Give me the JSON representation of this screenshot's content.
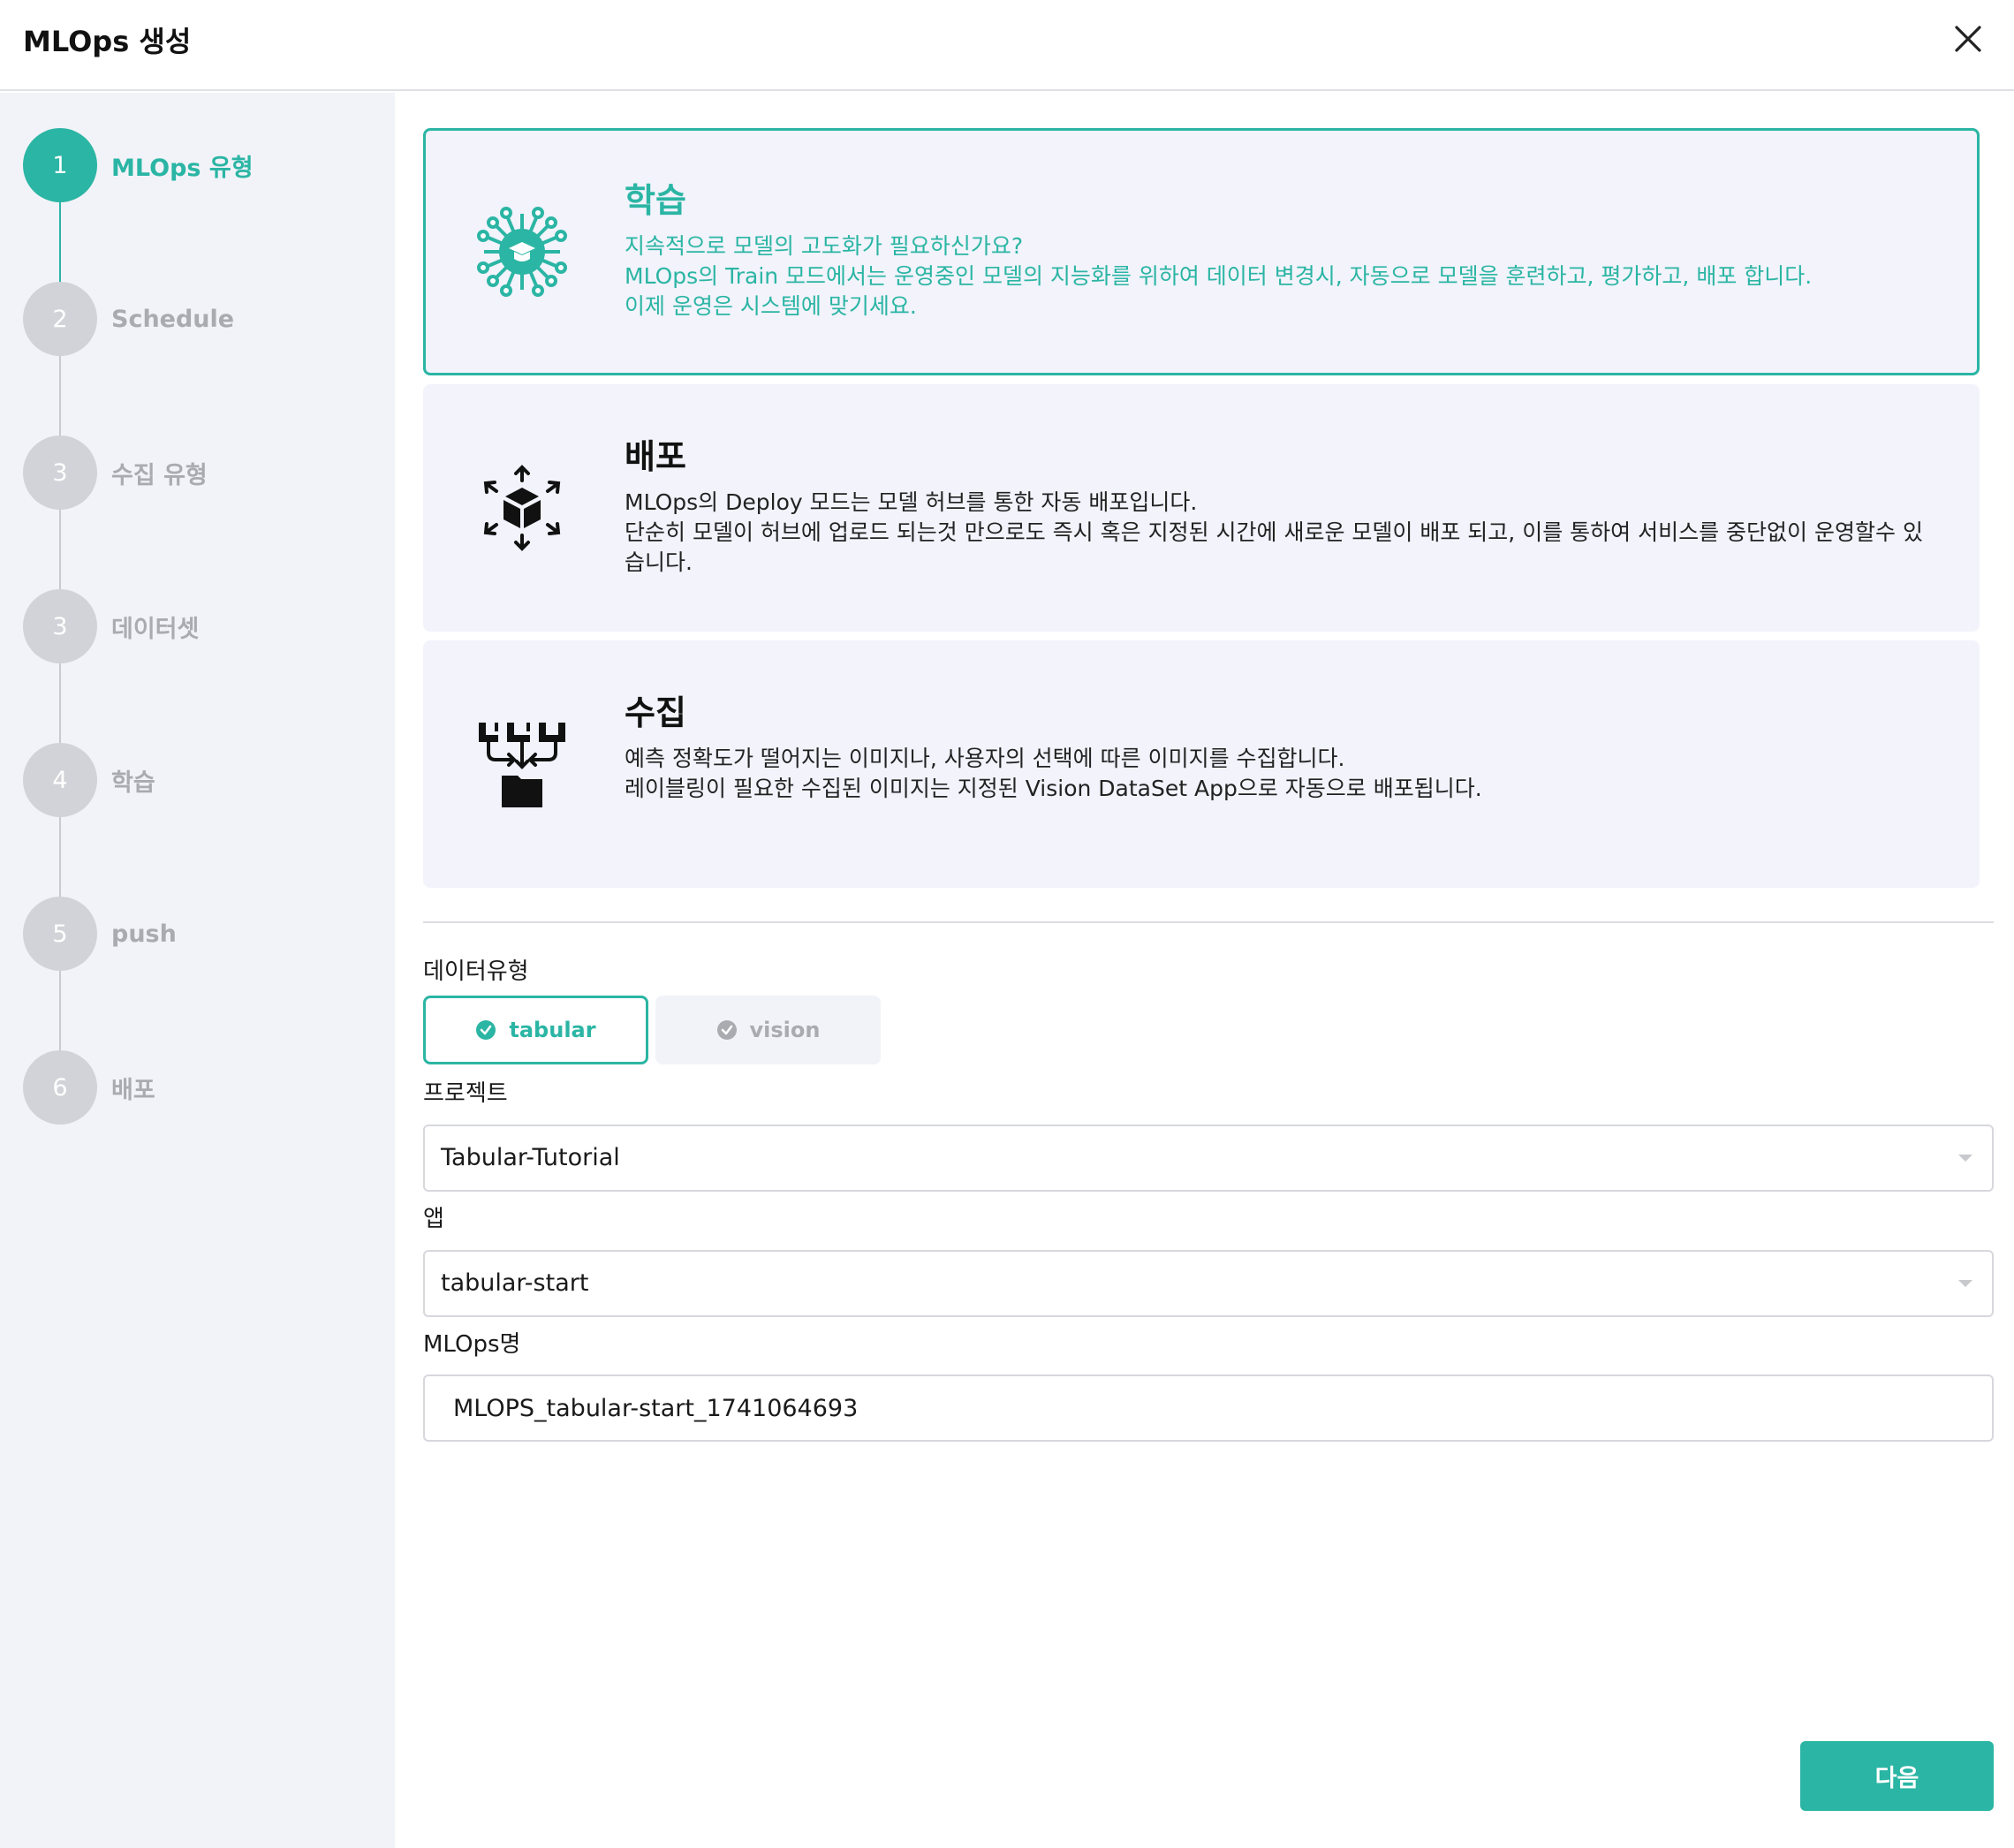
{
  "header": {
    "title": "MLOps 생성"
  },
  "steps": [
    {
      "num": "1",
      "label": "MLOps 유형",
      "active": true
    },
    {
      "num": "2",
      "label": "Schedule"
    },
    {
      "num": "3",
      "label": "수집 유형"
    },
    {
      "num": "3",
      "label": "데이터셋"
    },
    {
      "num": "4",
      "label": "학습"
    },
    {
      "num": "5",
      "label": "push"
    },
    {
      "num": "6",
      "label": "배포"
    }
  ],
  "cards": [
    {
      "title": "학습",
      "lines": [
        "지속적으로 모델의 고도화가 필요하신가요?",
        "MLOps의 Train 모드에서는 운영중인 모델의 지능화를 위하여 데이터 변경시, 자동으로 모델을 훈련하고, 평가하고, 배포 합니다.",
        "이제 운영은 시스템에 맞기세요."
      ],
      "icon": "graduation-network-icon",
      "selected": true
    },
    {
      "title": "배포",
      "lines": [
        "MLOps의 Deploy 모드는 모델 허브를 통한 자동 배포입니다.",
        "단순히 모델이 허브에 업로드 되는것 만으로도 즉시 혹은 지정된 시간에 새로운 모델이 배포 되고, 이를 통하여 서비스를 중단없이 운영할수 있습니다."
      ],
      "icon": "box-distribute-icon"
    },
    {
      "title": "수집",
      "lines": [
        "예측 정확도가 떨어지는 이미지나, 사용자의 선택에 따른 이미지를 수집합니다.",
        "레이블링이 필요한 수집된 이미지는 지정된 Vision DataSet App으로 자동으로 배포됩니다."
      ],
      "icon": "collect-folder-icon"
    }
  ],
  "form": {
    "data_type_label": "데이터유형",
    "data_types": [
      "tabular",
      "vision"
    ],
    "selected_data_type": "tabular",
    "project_label": "프로젝트",
    "project_value": "Tabular-Tutorial",
    "app_label": "앱",
    "app_value": "tabular-start",
    "name_label": "MLOps명",
    "name_value": "MLOPS_tabular-start_1741064693"
  },
  "footer": {
    "next_label": "다음"
  },
  "colors": {
    "accent": "#2bb5a4",
    "inactive": "#d2d3d8",
    "card_bg": "#f2f3fb",
    "sidebar_bg": "#f2f3f8"
  }
}
